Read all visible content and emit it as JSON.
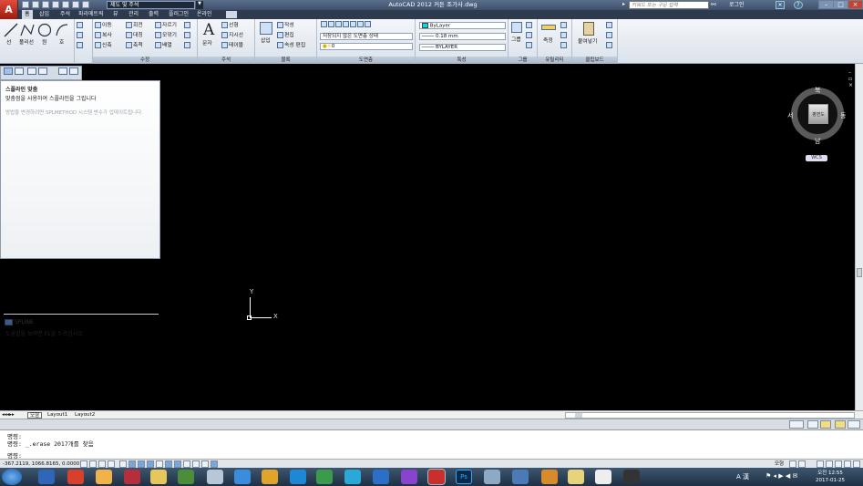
{
  "title_bar": {
    "workspace": "제도 및 주석",
    "window_title": "AutoCAD 2012    커튼 조가사.dwg",
    "search_placeholder": "키워드 또는 구문 입력",
    "login": "로그인"
  },
  "tabs": [
    "홈",
    "삽입",
    "주석",
    "파라메트릭",
    "뷰",
    "관리",
    "출력",
    "플러그인",
    "온라인"
  ],
  "ribbon": {
    "draw": {
      "line": "선",
      "polyline": "폴리선",
      "circle": "원",
      "arc": "호"
    },
    "modify": {
      "label": "수정",
      "move": "이동",
      "rotate": "회전",
      "trim": "자르기",
      "copy": "복사",
      "mirror": "대칭",
      "fillet": "모깎기",
      "stretch": "신축",
      "scale": "축척",
      "array": "배열"
    },
    "annotation": {
      "label": "주석",
      "text": "문자",
      "linear": "선형",
      "leader": "지시선",
      "table": "테이블"
    },
    "block": {
      "label": "블록",
      "insert": "삽입",
      "create": "작성",
      "edit": "편집",
      "attr_edit": "속성 편집"
    },
    "layers": {
      "label": "도면층",
      "state": "저장되지 않은 도면층 상태",
      "current": "0"
    },
    "properties": {
      "label": "특성",
      "color": "ByLayer",
      "lineweight": "0.18 mm",
      "linetype": "BYLAYER"
    },
    "groups": {
      "label": "그룹",
      "group": "그룹"
    },
    "utilities": {
      "label": "유틸리티",
      "measure": "측정"
    },
    "clipboard": {
      "label": "클립보드",
      "paste": "붙여넣기"
    }
  },
  "tooltip": {
    "title": "스플라인 맞춤",
    "description": "맞춤점을 사용하여 스플라인을 그립니다",
    "note": "방법을 변경하려면 SPLMETHOD 시스템 변수가 업데이트됩니다.",
    "command": "SPLINE",
    "help": "도움말을 보려면 F1을 누르십시오"
  },
  "viewcube": {
    "north": "북",
    "south": "남",
    "west": "서",
    "east": "동",
    "face": "평면도",
    "wcs": "WCS"
  },
  "ucs": {
    "x": "X",
    "y": "Y"
  },
  "layout_tabs": [
    "모형",
    "Layout1",
    "Layout2"
  ],
  "command_line": {
    "line1": "명령:",
    "line2": "명령: _.erase 2017개를 찾음",
    "prompt": "명령:"
  },
  "status": {
    "coords": "-367.2119, 1066.8165, 0.0000",
    "model": "모형"
  },
  "taskbar": {
    "time": "오전 12:55",
    "date": "2017-01-25",
    "ime": "A 漢"
  }
}
